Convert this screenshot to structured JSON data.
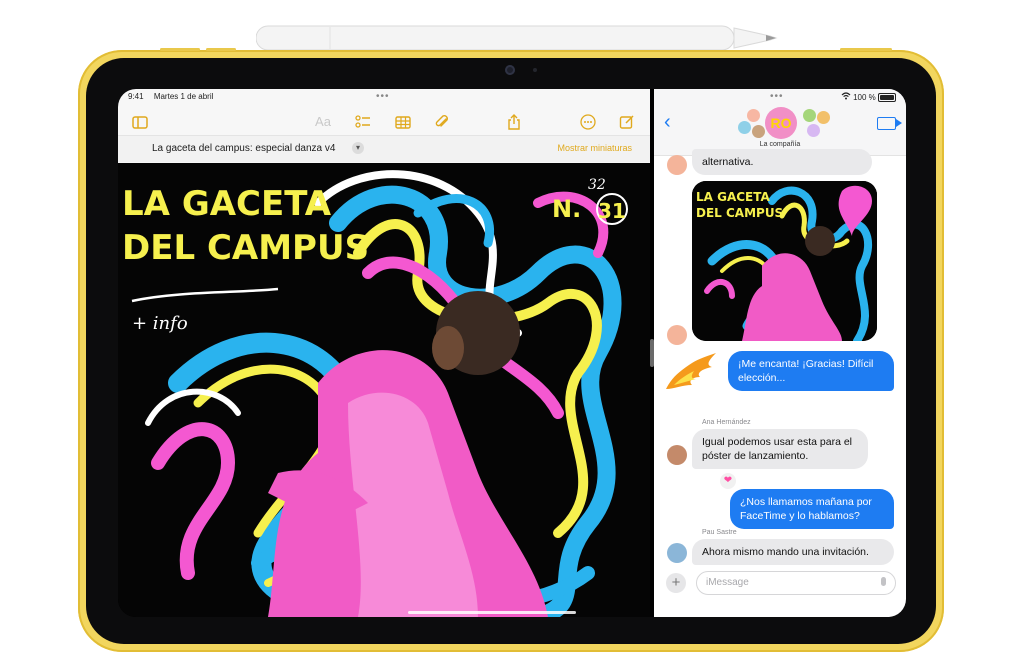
{
  "colors": {
    "accent_yellow": "#e0a91d",
    "imessage_blue": "#1e7cf2",
    "ipad_yellow": "#f2d65e"
  },
  "notes": {
    "status": {
      "time": "9:41",
      "date": "Martes 1 de abril"
    },
    "toolbar": {
      "icons": [
        "sidebar-icon",
        "format-icon",
        "checklist-icon",
        "table-icon",
        "attachment-icon",
        "share-icon",
        "more-icon",
        "compose-icon"
      ],
      "format_label": "Aa"
    },
    "document_title": "La gaceta del campus: especial danza v4",
    "show_thumbnails": "Mostrar miniaturas",
    "poster": {
      "line1": "LA GACETA",
      "line2": "DEL CAMPUS",
      "info": "+ info",
      "issue_prefix": "N.",
      "issue_old": "32",
      "issue_new": "31"
    }
  },
  "messages": {
    "status": {
      "battery": "100 %"
    },
    "group_initials": "RO",
    "group_name": "La compañía",
    "thread": [
      {
        "type": "in",
        "text": "alternativa."
      },
      {
        "type": "image"
      },
      {
        "type": "out",
        "text": "¡Me encanta! ¡Gracias! Difícil elección..."
      },
      {
        "type": "in",
        "sender": "Ana Hernández",
        "text": "Igual podemos usar esta para el póster de lanzamiento."
      },
      {
        "type": "out",
        "text": "¿Nos llamamos mañana por FaceTime y lo hablamos?"
      },
      {
        "type": "in",
        "sender": "Pau Sastre",
        "text": "Ahora mismo mando una invitación."
      }
    ],
    "input_placeholder": "iMessage"
  }
}
